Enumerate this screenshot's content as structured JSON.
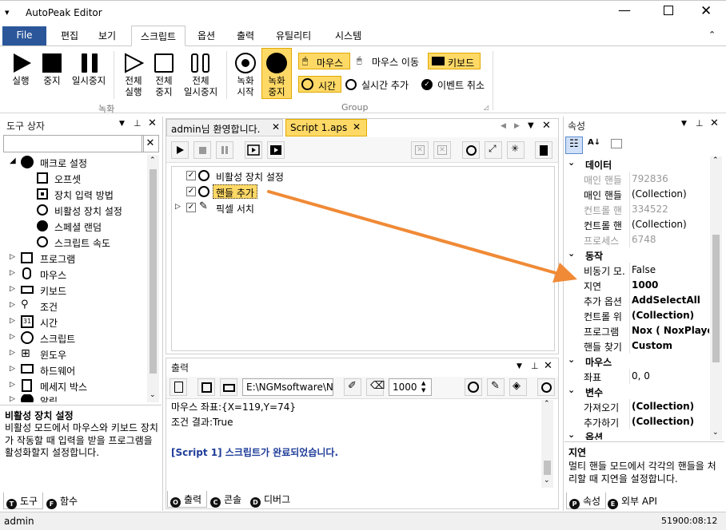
{
  "window": {
    "title": "AutoPeak Editor"
  },
  "menu": {
    "items": [
      "File",
      "편집",
      "보기",
      "스크립트",
      "옵션",
      "출력",
      "유틸리티",
      "시스템"
    ]
  },
  "ribbon": {
    "run": "실행",
    "stop": "중지",
    "pause": "일시중지",
    "run_all_1": "전체",
    "run_all_2": "실행",
    "stop_all_1": "전체",
    "stop_all_2": "중지",
    "pause_all_1": "전체",
    "pause_all_2": "일시중지",
    "rec_start_1": "녹화",
    "rec_start_2": "시작",
    "rec_stop_1": "녹화",
    "rec_stop_2": "중지",
    "group_record": "녹화",
    "mouse": "마우스",
    "mouse_move": "마우스 이동",
    "keyboard": "키보드",
    "time": "시간",
    "realtime_add": "실시간 추가",
    "event_cancel": "이벤트 취소",
    "group_group": "Group"
  },
  "toolbox": {
    "title": "도구 상자",
    "macro_settings": "매크로 설정",
    "children": [
      "오프셋",
      "장치 입력 방법",
      "비활성 장치 설정",
      "스페셜 랜덤",
      "스크립트 속도"
    ],
    "categories": [
      "프로그램",
      "마우스",
      "키보드",
      "조건",
      "시간",
      "스크립트",
      "윈도우",
      "하드웨어",
      "메세지 박스",
      "알림"
    ],
    "desc_title": "비활성 장치 설정",
    "desc": "비활성 모드에서 마우스와 키보드 장치가 작동할 때 입력을 받을 프로그램을 활성화할지 설정합니다.",
    "tab_tools": "도구",
    "tab_funcs": "함수"
  },
  "editor": {
    "tab_welcome": "admin님 환영합니다.",
    "tab_script": "Script 1.aps",
    "lines": [
      "비활성 장치 설정",
      "핸들 추가",
      "픽셀 서치"
    ]
  },
  "output": {
    "title": "출력",
    "path": "E:\\NGMsoftware\\NG",
    "delay": "1000",
    "lines": [
      "마우스 좌표:{X=119,Y=74}",
      "조건 결과:True",
      "",
      "[Script 1] 스크립트가 완료되었습니다."
    ],
    "tab_output": "출력",
    "tab_console": "콘솔",
    "tab_debug": "디버그"
  },
  "properties": {
    "title": "속성",
    "sections": [
      {
        "name": "데이터",
        "rows": [
          [
            "매인 핸들",
            "792836"
          ],
          [
            "매인 핸들",
            "(Collection)"
          ],
          [
            "컨트롤 핸",
            "334522"
          ],
          [
            "컨트롤 핸",
            "(Collection)"
          ],
          [
            "프로세스",
            "6748"
          ]
        ]
      },
      {
        "name": "동작",
        "rows": [
          [
            "비동기 모.",
            "False"
          ],
          [
            "지연",
            "1000"
          ],
          [
            "추가 옵션",
            "AddSelectAll"
          ],
          [
            "컨트롤 위",
            "(Collection)"
          ],
          [
            "프로그램",
            "Nox ( NoxPlayer"
          ],
          [
            "핸들 찾기",
            "Custom"
          ]
        ]
      },
      {
        "name": "마우스",
        "rows": [
          [
            "좌표",
            "0, 0"
          ]
        ]
      },
      {
        "name": "변수",
        "rows": [
          [
            "가져오기",
            "(Collection)"
          ],
          [
            "추가하기",
            "(Collection)"
          ]
        ]
      },
      {
        "name": "옵션",
        "rows": []
      }
    ],
    "desc_title": "지연",
    "desc": "멀티 핸들 모드에서 각각의 핸들을 처리할 때 지연을 설정합니다.",
    "tab_props": "속성",
    "tab_api": "외부 API"
  },
  "status": {
    "user": "admin",
    "time": "51900:08:12"
  },
  "colors": {
    "accent": "#2b579a",
    "highlight": "#ffd966",
    "arrow": "#f08a36"
  }
}
